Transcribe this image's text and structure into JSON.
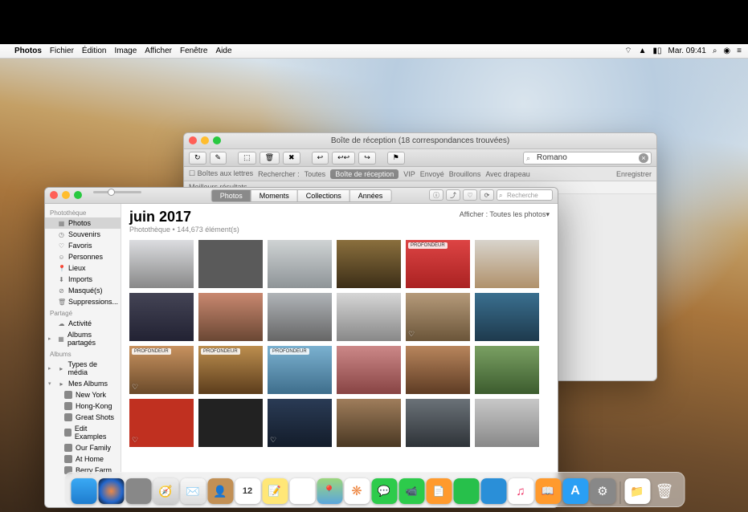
{
  "menubar": {
    "apple": "",
    "items": [
      "Photos",
      "Fichier",
      "Édition",
      "Image",
      "Afficher",
      "Fenêtre",
      "Aide"
    ],
    "right": {
      "wifi": "wifi-icon",
      "airplay": "airplay-icon",
      "battery": "battery-icon",
      "clock": "Mar. 09:41",
      "search": "search-icon",
      "siri": "siri-icon",
      "menu": "menu-icon"
    }
  },
  "mail": {
    "title": "Boîte de réception (18 correspondances trouvées)",
    "search": "Romano",
    "filter": {
      "boites": "Boîtes aux lettres",
      "label": "Rechercher :",
      "scopes": [
        "Toutes",
        "Boîte de réception",
        "VIP",
        "Envoyé",
        "Brouillons",
        "Avec drapeau"
      ],
      "active": 1,
      "save": "Enregistrer"
    },
    "best": "Meilleurs résultats"
  },
  "photos": {
    "tabs": [
      "Photos",
      "Moments",
      "Collections",
      "Années"
    ],
    "active_tab": 0,
    "search_placeholder": "Recherche",
    "sidebar": {
      "sections": [
        {
          "header": "Photothèque",
          "items": [
            {
              "label": "Photos",
              "icon": "photos",
              "selected": true
            },
            {
              "label": "Souvenirs",
              "icon": "memories"
            },
            {
              "label": "Favoris",
              "icon": "heart"
            },
            {
              "label": "Personnes",
              "icon": "people"
            },
            {
              "label": "Lieux",
              "icon": "places"
            },
            {
              "label": "Imports",
              "icon": "imports"
            },
            {
              "label": "Masqué(s)",
              "icon": "hidden"
            },
            {
              "label": "Suppressions...",
              "icon": "trash"
            }
          ]
        },
        {
          "header": "Partagé",
          "items": [
            {
              "label": "Activité",
              "icon": "cloud"
            },
            {
              "label": "Albums partagés",
              "icon": "shared",
              "disclosure": true
            }
          ]
        },
        {
          "header": "Albums",
          "items": [
            {
              "label": "Types de média",
              "icon": "folder",
              "disclosure": true
            },
            {
              "label": "Mes Albums",
              "icon": "folder",
              "disclosure": true,
              "expanded": true,
              "children": [
                {
                  "label": "New York"
                },
                {
                  "label": "Hong-Kong"
                },
                {
                  "label": "Great Shots"
                },
                {
                  "label": "Edit Examples"
                },
                {
                  "label": "Our Family"
                },
                {
                  "label": "At Home"
                },
                {
                  "label": "Berry Farm"
                }
              ]
            }
          ]
        }
      ]
    },
    "header": {
      "title": "juin 2017",
      "subtitle": "Photothèque • 144,673 élément(s)",
      "display": "Afficher : Toutes les photos",
      "chevron": "▾"
    },
    "badges": {
      "depth": "PROFONDEUR"
    },
    "grid": [
      [
        {
          "c": "t1"
        },
        {
          "c": "t2"
        },
        {
          "c": "t3"
        },
        {
          "c": "t4"
        },
        {
          "c": "t5",
          "badge": "depth"
        },
        {
          "c": "t6"
        }
      ],
      [
        {
          "c": "t7"
        },
        {
          "c": "t8"
        },
        {
          "c": "t9"
        },
        {
          "c": "t10"
        },
        {
          "c": "t11",
          "heart": true
        },
        {
          "c": "t12"
        }
      ],
      [
        {
          "c": "t13",
          "badge": "depth",
          "heart": true
        },
        {
          "c": "t14",
          "badge": "depth"
        },
        {
          "c": "t15",
          "badge": "depth"
        },
        {
          "c": "t16"
        },
        {
          "c": "t17"
        },
        {
          "c": "t18"
        }
      ],
      [
        {
          "c": "t19",
          "heart": true
        },
        {
          "c": "t20"
        },
        {
          "c": "t21",
          "heart": true
        },
        {
          "c": "t22"
        },
        {
          "c": "t23"
        },
        {
          "c": "t24"
        }
      ]
    ]
  },
  "dock": [
    "finder",
    "siri",
    "launchpad",
    "safari",
    "mail",
    "contacts",
    "calendar",
    "notes",
    "reminders",
    "maps",
    "photos",
    "messages",
    "facetime",
    "pages",
    "numbers",
    "keynote",
    "itunes",
    "ibooks",
    "appstore",
    "sysprefs",
    "|",
    "downloads",
    "trash"
  ]
}
